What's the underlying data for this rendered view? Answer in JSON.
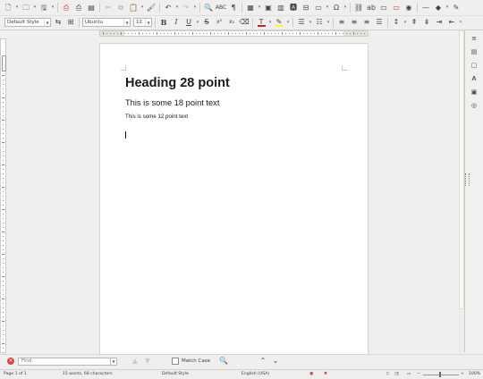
{
  "toolbar1": {
    "icons": [
      "new-document-icon",
      "open-folder-icon",
      "save-icon",
      "export-pdf-icon",
      "print-icon",
      "print-preview-icon",
      "cut-icon",
      "copy-icon",
      "paste-icon",
      "clone-formatting-icon",
      "undo-icon",
      "redo-icon",
      "find-replace-icon",
      "spellcheck-icon",
      "formatting-marks-icon",
      "insert-table-icon",
      "insert-image-icon",
      "insert-chart-icon",
      "insert-textbox-icon",
      "insert-page-break-icon",
      "insert-field-icon",
      "special-character-icon",
      "hyperlink-icon",
      "footnote-icon",
      "comment-icon",
      "track-changes-icon",
      "insert-line-icon",
      "basic-shapes-icon",
      "draw-functions-icon"
    ]
  },
  "toolbar2": {
    "paragraph_style": "Default Style",
    "font_name": "Ubuntu",
    "font_size": "12",
    "bold_label": "B",
    "italic_label": "I",
    "underline_label": "U",
    "strike_label": "S",
    "font_color_letter": "T",
    "font_color": "#c9211e",
    "highlight_color": "#ffff00"
  },
  "document": {
    "heading": "Heading 28 point",
    "subheading": "This is some 18 point text",
    "body": "This is some 12 point text"
  },
  "sidebar": {
    "icons": [
      "properties-icon",
      "page-icon",
      "styles-icon",
      "gallery-icon",
      "navigator-icon"
    ]
  },
  "findbar": {
    "placeholder": "Find",
    "match_case_label": "Match Case"
  },
  "status": {
    "page": "Page 1 of 1",
    "words": "15 words, 68 characters",
    "page_style": "Default Style",
    "language": "English (USA)",
    "zoom": "100%"
  }
}
